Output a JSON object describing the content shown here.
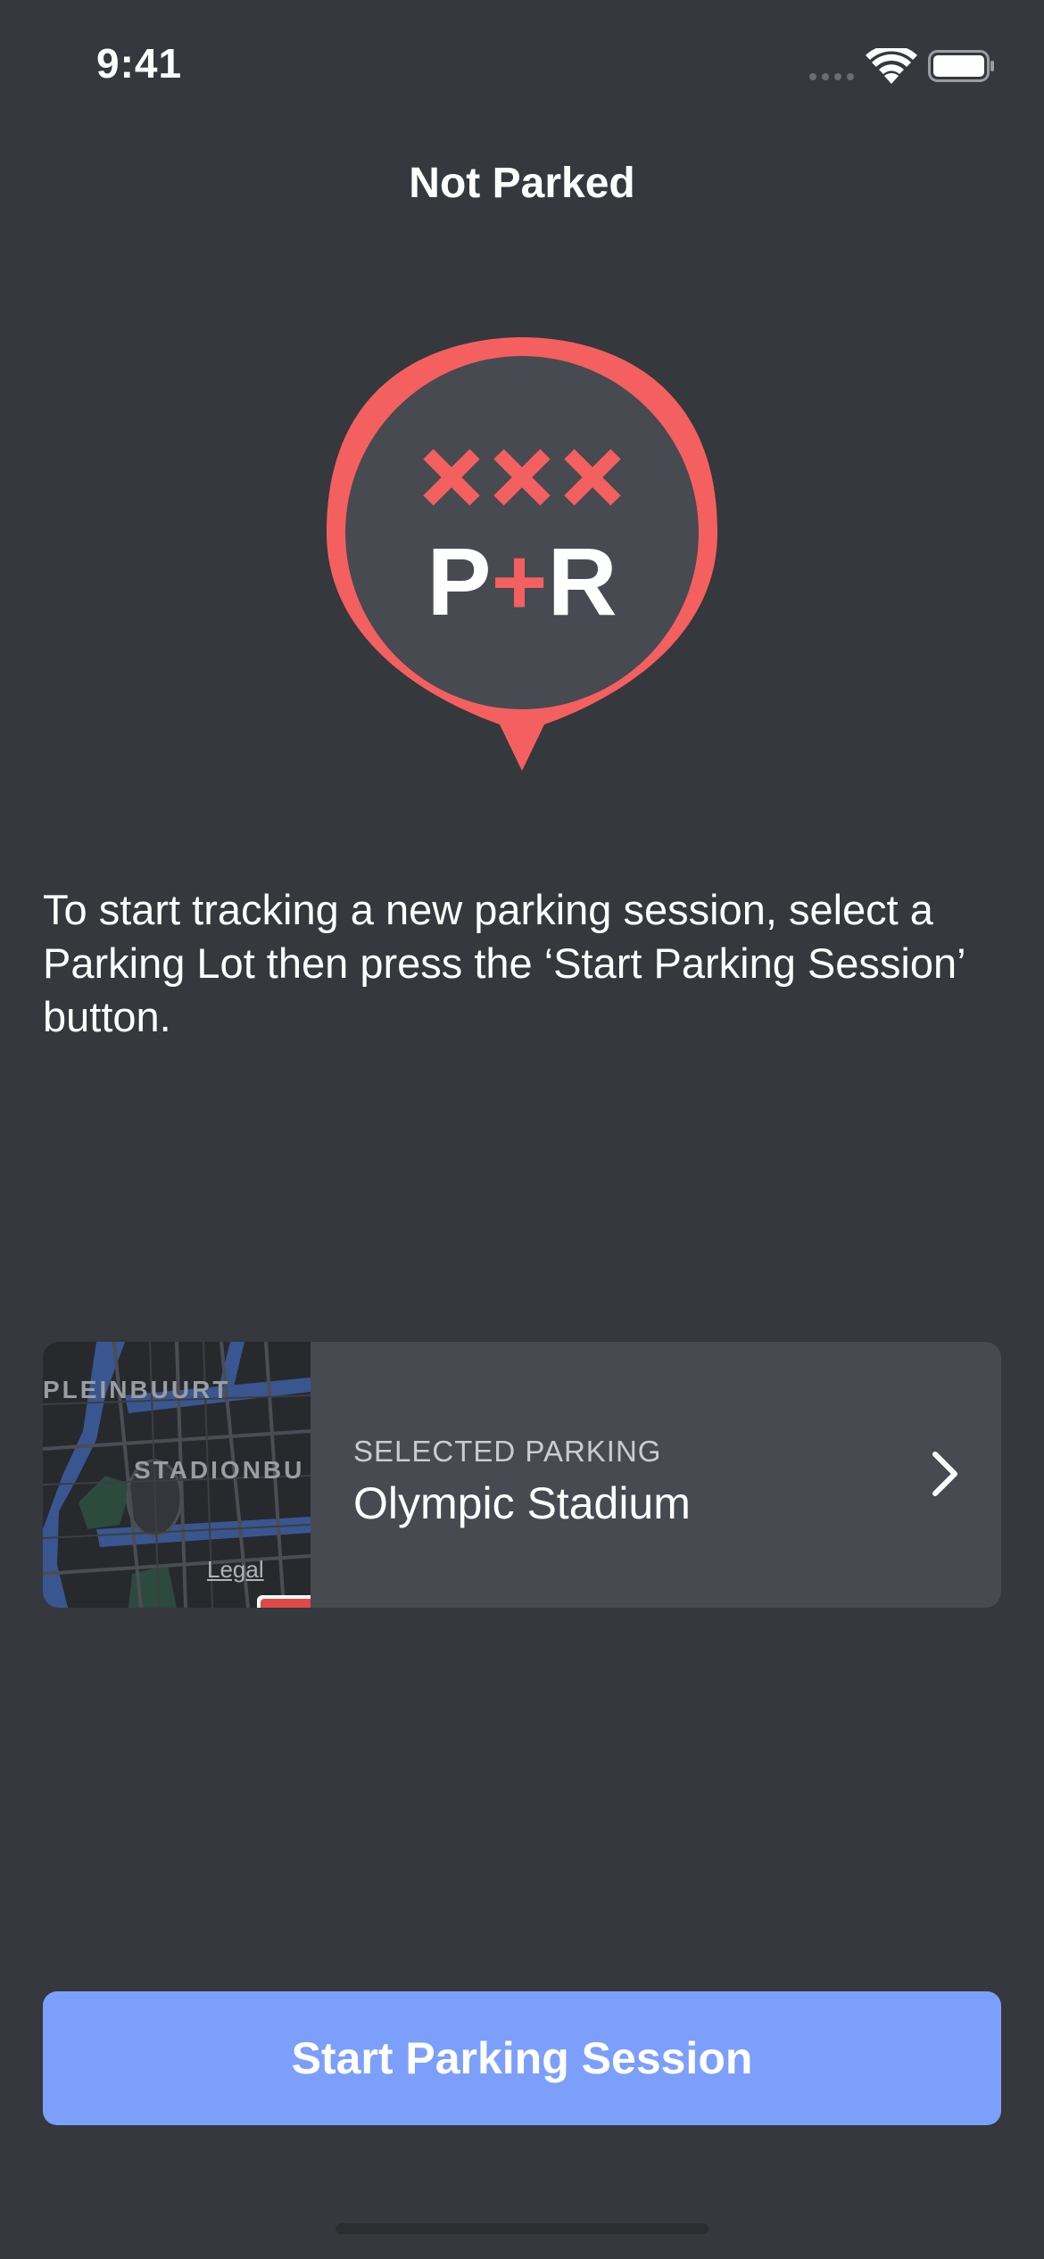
{
  "status_bar": {
    "time": "9:41",
    "signal_icon": "cellular-signal-icon",
    "wifi_icon": "wifi-icon",
    "battery_icon": "battery-icon"
  },
  "nav": {
    "title": "Not Parked"
  },
  "logo": {
    "text": "P+R",
    "icon": "park-and-ride-pin-icon",
    "accent_color": "#f4605f"
  },
  "description": "To start tracking a new parking session, select a Parking Lot then press the ‘Start Parking Session’ button.",
  "selected_parking": {
    "caption": "SELECTED PARKING",
    "name": "Olympic Stadium",
    "map_labels": [
      "PLEINBUURT",
      "STADIONBU"
    ],
    "map_legal": "Legal",
    "chevron_icon": "chevron-right-icon"
  },
  "actions": {
    "start_label": "Start Parking Session",
    "button_color": "#7c9ffc"
  },
  "colors": {
    "background": "#35383c",
    "card": "#474a50"
  }
}
